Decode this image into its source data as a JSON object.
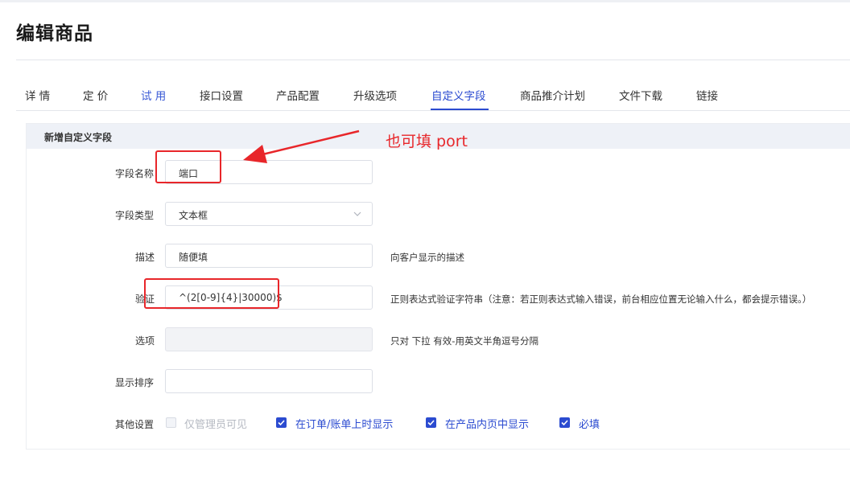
{
  "page": {
    "title": "编辑商品"
  },
  "tabs": [
    {
      "label": "详 情"
    },
    {
      "label": "定 价"
    },
    {
      "label": "试 用"
    },
    {
      "label": "接口设置"
    },
    {
      "label": "产品配置"
    },
    {
      "label": "升级选项"
    },
    {
      "label": "自定义字段"
    },
    {
      "label": "商品推介计划"
    },
    {
      "label": "文件下载"
    },
    {
      "label": "链接"
    }
  ],
  "active_tab": "自定义字段",
  "panel": {
    "title": "新增自定义字段"
  },
  "form": {
    "field_name": {
      "label": "字段名称",
      "value": "端口"
    },
    "field_type": {
      "label": "字段类型",
      "value": "文本框"
    },
    "description": {
      "label": "描述",
      "value": "随便填",
      "hint": "向客户显示的描述"
    },
    "validation": {
      "label": "验证",
      "value": "^(2[0-9]{4}|30000)$",
      "hint": "正则表达式验证字符串（注意：若正则表达式输入错误，前台相应位置无论输入什么，都会提示错误。）"
    },
    "options": {
      "label": "选项",
      "value": "",
      "hint": "只对 下拉 有效-用英文半角逗号分隔"
    },
    "sort_order": {
      "label": "显示排序",
      "value": ""
    },
    "other": {
      "label": "其他设置",
      "checkboxes": [
        {
          "label": "仅管理员可见",
          "checked": false
        },
        {
          "label": "在订单/账单上时显示",
          "checked": true
        },
        {
          "label": "在产品内页中显示",
          "checked": true
        },
        {
          "label": "必填",
          "checked": true
        }
      ]
    }
  },
  "annotation": {
    "note": "也可填 port",
    "color": "#e8262a"
  },
  "colors": {
    "accent": "#2b4bd0",
    "annotation_red": "#e8262a",
    "panel_header": "#eef1f7"
  }
}
